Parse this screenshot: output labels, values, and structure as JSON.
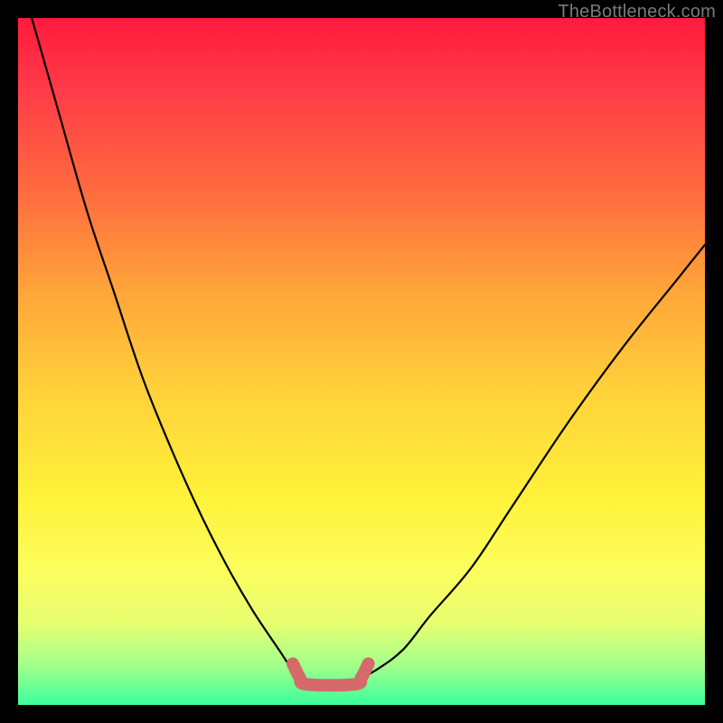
{
  "watermark": "TheBottleneck.com",
  "chart_data": {
    "type": "line",
    "title": "",
    "xlabel": "",
    "ylabel": "",
    "x_range": [
      0,
      100
    ],
    "y_range": [
      0,
      100
    ],
    "series": [
      {
        "name": "left-curve",
        "x": [
          2,
          6,
          10,
          14,
          18,
          22,
          26,
          30,
          34,
          38,
          40,
          41
        ],
        "y": [
          100,
          86,
          72,
          60,
          48,
          38,
          29,
          21,
          14,
          8,
          5,
          4
        ]
      },
      {
        "name": "right-curve",
        "x": [
          50,
          52,
          56,
          60,
          66,
          72,
          80,
          88,
          96,
          100
        ],
        "y": [
          4,
          5,
          8,
          13,
          20,
          29,
          41,
          52,
          62,
          67
        ]
      },
      {
        "name": "trough-highlight",
        "x": [
          40,
          41,
          42,
          49,
          50,
          51
        ],
        "y": [
          6,
          4,
          3,
          3,
          4,
          6
        ]
      }
    ],
    "gradient_stops": [
      {
        "pos": 0,
        "color": "#ff1a3c"
      },
      {
        "pos": 10,
        "color": "#ff3a48"
      },
      {
        "pos": 25,
        "color": "#ff6a3e"
      },
      {
        "pos": 40,
        "color": "#ffa63a"
      },
      {
        "pos": 55,
        "color": "#ffd33a"
      },
      {
        "pos": 70,
        "color": "#fff23a"
      },
      {
        "pos": 80,
        "color": "#fdfd5c"
      },
      {
        "pos": 88,
        "color": "#e7ff70"
      },
      {
        "pos": 94,
        "color": "#a6ff8a"
      },
      {
        "pos": 100,
        "color": "#3cff9c"
      }
    ]
  }
}
